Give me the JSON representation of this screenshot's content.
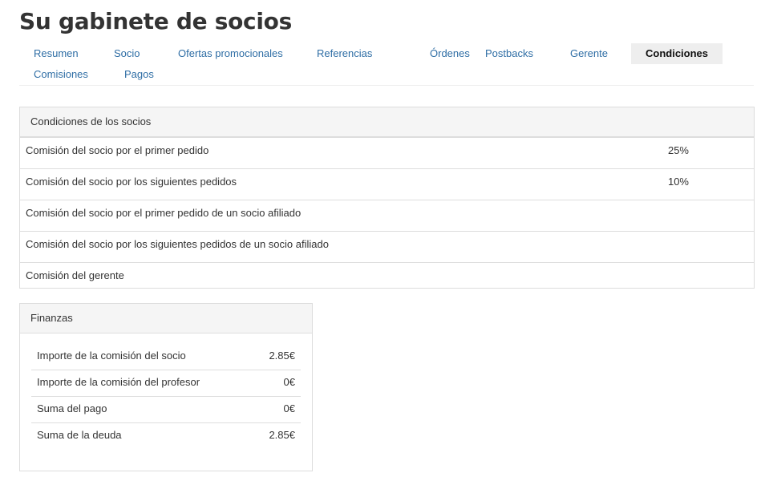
{
  "page": {
    "title": "Su gabinete de socios"
  },
  "tabs": [
    {
      "label": "Resumen"
    },
    {
      "label": "Socio"
    },
    {
      "label": "Ofertas promocionales"
    },
    {
      "label": "Referencias"
    },
    {
      "label": "Órdenes"
    },
    {
      "label": "Postbacks"
    },
    {
      "label": "Gerente"
    },
    {
      "label": "Condiciones",
      "active": true
    },
    {
      "label": "Comisiones"
    },
    {
      "label": "Pagos"
    }
  ],
  "conditions": {
    "heading": "Condiciones de los socios",
    "rows": [
      {
        "label": "Comisión del socio por el primer pedido",
        "value": "25%"
      },
      {
        "label": "Comisión del socio por los siguientes pedidos",
        "value": "10%"
      },
      {
        "label": "Comisión del socio por el primer pedido de un socio afiliado",
        "value": ""
      },
      {
        "label": "Comisión del socio por los siguientes pedidos de un socio afiliado",
        "value": ""
      },
      {
        "label": "Comisión del gerente",
        "value": ""
      }
    ]
  },
  "finances": {
    "heading": "Finanzas",
    "rows": [
      {
        "label": "Importe de la comisión del socio",
        "value": "2.85€"
      },
      {
        "label": "Importe de la comisión del profesor",
        "value": "0€"
      },
      {
        "label": "Suma del pago",
        "value": "0€"
      },
      {
        "label": "Suma de la deuda",
        "value": "2.85€"
      }
    ]
  }
}
